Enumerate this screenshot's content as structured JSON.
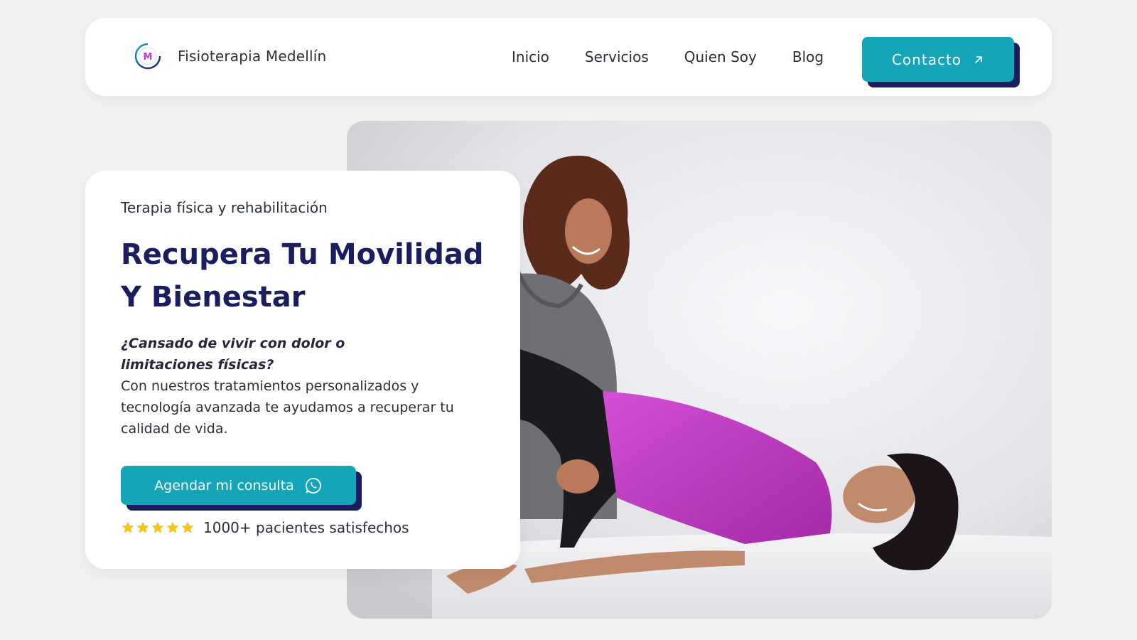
{
  "brand": {
    "name": "Fisioterapia Medellín",
    "logo_text": "M"
  },
  "nav": {
    "links": [
      {
        "label": "Inicio"
      },
      {
        "label": "Servicios"
      },
      {
        "label": "Quien Soy"
      },
      {
        "label": "Blog"
      }
    ],
    "contact_label": "Contacto",
    "contact_icon": "arrow-up-right-icon"
  },
  "hero": {
    "eyebrow": "Terapia física y rehabilitación",
    "headline": "Recupera Tu Movilidad Y Bienestar",
    "question": "¿Cansado de vivir con dolor o limitaciones físicas?",
    "description": "Con nuestros tratamientos personalizados y tecnología avanzada te ayudamos a recuperar tu calidad de vida.",
    "cta_label": "Agendar mi consulta",
    "cta_icon": "whatsapp-icon",
    "rating_stars": 5,
    "rating_text": "1000+ pacientes satisfechos",
    "image_icon": "physiotherapy-session-photo"
  },
  "colors": {
    "accent": "#14a6b8",
    "accent_shadow": "#1b1e5e",
    "headline": "#1b1e5e",
    "background": "#f1f1f1",
    "star": "#f5c518",
    "patient_top": "#c23cc6"
  }
}
